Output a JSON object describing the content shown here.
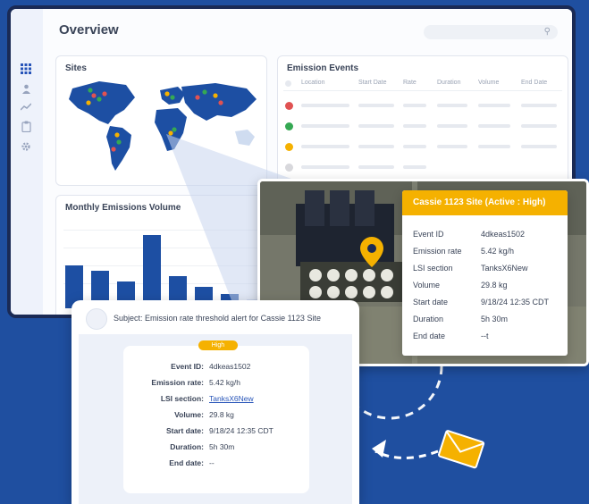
{
  "dashboard": {
    "title": "Overview",
    "sidebar_icons": [
      "grid-icon",
      "user-icon",
      "trend-icon",
      "clipboard-icon",
      "gear-icon"
    ],
    "sites_title": "Sites",
    "events": {
      "title": "Emission Events",
      "columns": [
        "Location",
        "Start Date",
        "Rate",
        "Duration",
        "Volume",
        "End Date"
      ],
      "status_colors": [
        "#e05252",
        "#35a853",
        "#f5b100",
        "#d8d8dc"
      ]
    },
    "monthly": {
      "title": "Monthly Emissions Volume"
    }
  },
  "chart_data": {
    "type": "bar",
    "title": "Monthly Emissions Volume",
    "values": [
      48,
      42,
      30,
      82,
      36,
      24,
      16,
      10
    ]
  },
  "site_popup": {
    "title": "Cassie 1123 Site (Active : High)",
    "rows": [
      {
        "label": "Event ID",
        "value": "4dkeas1502"
      },
      {
        "label": "Emission rate",
        "value": "5.42 kg/h"
      },
      {
        "label": "LSI section",
        "value": "TanksX6New"
      },
      {
        "label": "Volume",
        "value": "29.8 kg"
      },
      {
        "label": "Start date",
        "value": "9/18/24 12:35 CDT"
      },
      {
        "label": "Duration",
        "value": "5h 30m"
      },
      {
        "label": "End date",
        "value": "--t"
      }
    ]
  },
  "email": {
    "subject": "Subject: Emission rate threshold alert for Cassie 1123 Site",
    "badge": "High",
    "rows": [
      {
        "label": "Event ID:",
        "value": "4dkeas1502"
      },
      {
        "label": "Emission rate:",
        "value": "5.42 kg/h"
      },
      {
        "label": "LSI section:",
        "value": "TanksX6New"
      },
      {
        "label": "Volume:",
        "value": "29.8 kg"
      },
      {
        "label": "Start date:",
        "value": "9/18/24 12:35 CDT"
      },
      {
        "label": "Duration:",
        "value": "5h 30m"
      },
      {
        "label": "End date:",
        "value": "--"
      }
    ]
  },
  "colors": {
    "brand_blue": "#1f4fa0",
    "accent_yellow": "#f5b100"
  }
}
